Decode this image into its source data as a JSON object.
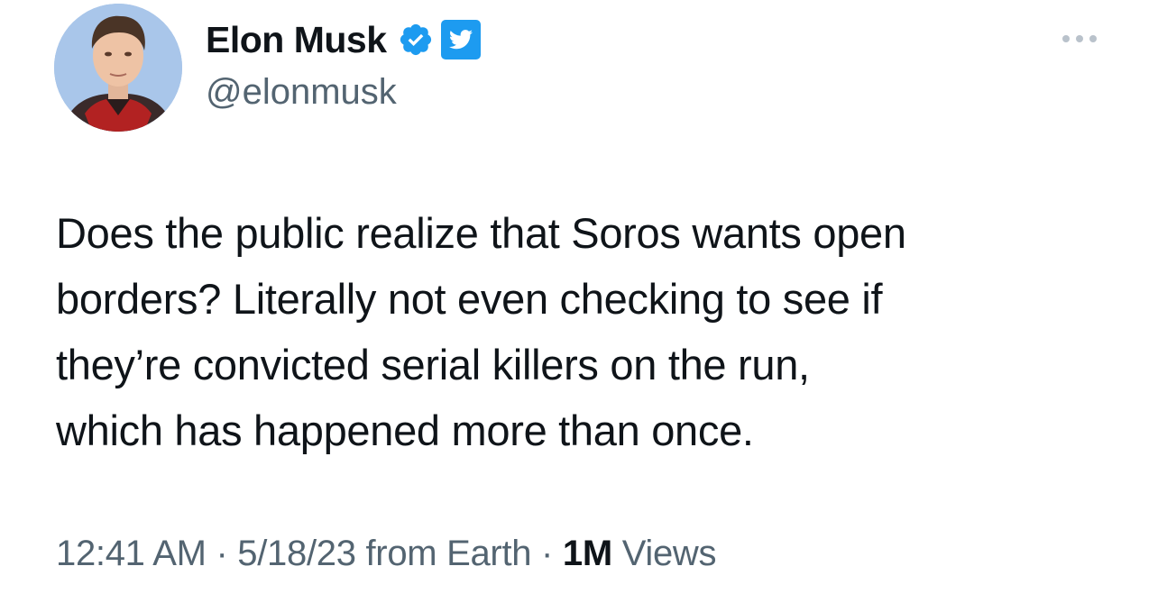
{
  "author": {
    "display_name": "Elon Musk",
    "handle": "@elonmusk",
    "verified_icon": "verified-badge-icon",
    "badge_icon": "twitter-bird-icon",
    "verified_color": "#1d9bf0"
  },
  "menu": {
    "icon": "more-options-icon"
  },
  "tweet": {
    "text_lines": [
      "Does the public realize that Soros wants open",
      "borders? Literally not even checking to see if",
      "they’re convicted serial killers on the run,",
      "which has happened more than once."
    ]
  },
  "meta": {
    "time": "12:41 AM",
    "separator": "·",
    "date": "5/18/23",
    "source": "from Earth",
    "views_count": "1M",
    "views_label": "Views"
  },
  "colors": {
    "text_primary": "#0f1419",
    "text_secondary": "#536471",
    "accent": "#1d9bf0"
  }
}
